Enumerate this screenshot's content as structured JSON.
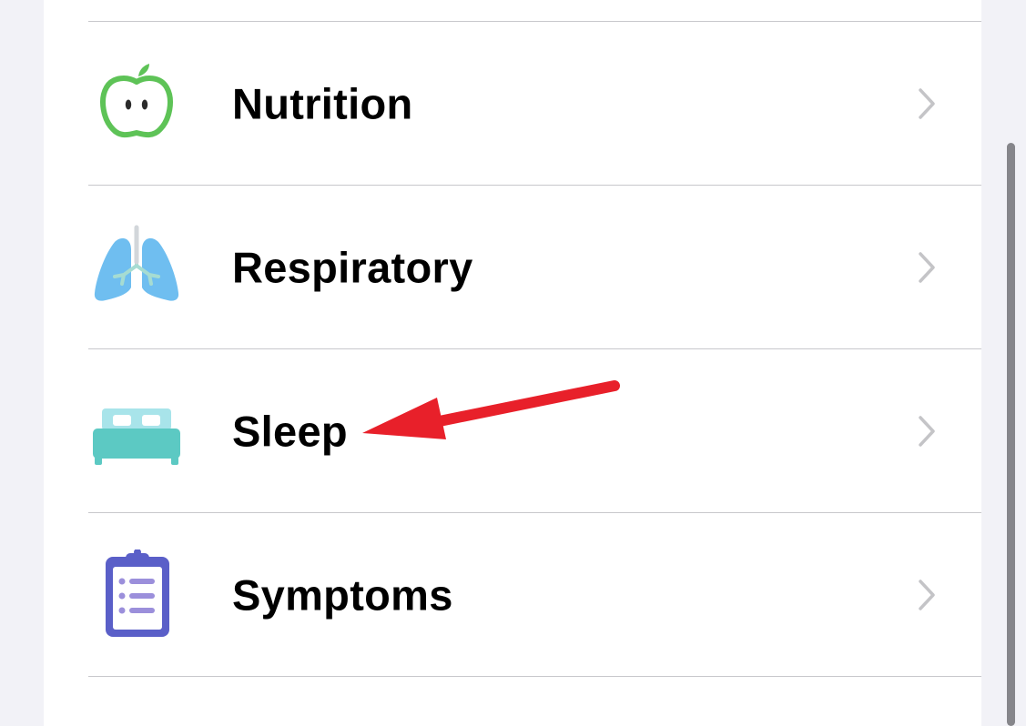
{
  "list": {
    "items": [
      {
        "label": "Nutrition",
        "icon": "apple-icon"
      },
      {
        "label": "Respiratory",
        "icon": "lungs-icon"
      },
      {
        "label": "Sleep",
        "icon": "bed-icon"
      },
      {
        "label": "Symptoms",
        "icon": "clipboard-icon"
      }
    ]
  },
  "colors": {
    "nutrition_green": "#5ec357",
    "respiratory_blue": "#6fbef0",
    "sleep_teal": "#5cc9c3",
    "symptoms_purple": "#5a5fc8",
    "annotation_red": "#e8202a"
  }
}
